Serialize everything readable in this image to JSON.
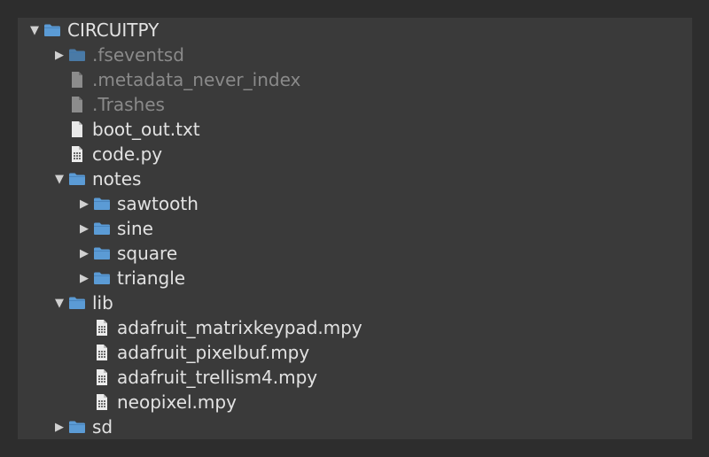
{
  "tree": [
    {
      "label": "CIRCUITPY",
      "type": "folder",
      "depth": 0,
      "state": "expanded",
      "dim": false
    },
    {
      "label": ".fseventsd",
      "type": "folder",
      "depth": 1,
      "state": "collapsed",
      "dim": true
    },
    {
      "label": ".metadata_never_index",
      "type": "file",
      "depth": 1,
      "state": "leaf",
      "dim": true
    },
    {
      "label": ".Trashes",
      "type": "file",
      "depth": 1,
      "state": "leaf",
      "dim": true
    },
    {
      "label": "boot_out.txt",
      "type": "file",
      "depth": 1,
      "state": "leaf",
      "dim": false
    },
    {
      "label": "code.py",
      "type": "code",
      "depth": 1,
      "state": "leaf",
      "dim": false
    },
    {
      "label": "notes",
      "type": "folder",
      "depth": 1,
      "state": "expanded",
      "dim": false
    },
    {
      "label": "sawtooth",
      "type": "folder",
      "depth": 2,
      "state": "collapsed",
      "dim": false
    },
    {
      "label": "sine",
      "type": "folder",
      "depth": 2,
      "state": "collapsed",
      "dim": false
    },
    {
      "label": "square",
      "type": "folder",
      "depth": 2,
      "state": "collapsed",
      "dim": false
    },
    {
      "label": "triangle",
      "type": "folder",
      "depth": 2,
      "state": "collapsed",
      "dim": false
    },
    {
      "label": "lib",
      "type": "folder",
      "depth": 1,
      "state": "expanded",
      "dim": false
    },
    {
      "label": "adafruit_matrixkeypad.mpy",
      "type": "code",
      "depth": 2,
      "state": "leaf",
      "dim": false
    },
    {
      "label": "adafruit_pixelbuf.mpy",
      "type": "code",
      "depth": 2,
      "state": "leaf",
      "dim": false
    },
    {
      "label": "adafruit_trellism4.mpy",
      "type": "code",
      "depth": 2,
      "state": "leaf",
      "dim": false
    },
    {
      "label": "neopixel.mpy",
      "type": "code",
      "depth": 2,
      "state": "leaf",
      "dim": false
    },
    {
      "label": "sd",
      "type": "folder",
      "depth": 1,
      "state": "collapsed",
      "dim": false
    }
  ],
  "colors": {
    "background": "#2d2d2d",
    "panel": "#3a3a3a",
    "folder": "#5b9bd5",
    "text": "#e2e2e2",
    "dim_text": "#8a8a8a"
  }
}
